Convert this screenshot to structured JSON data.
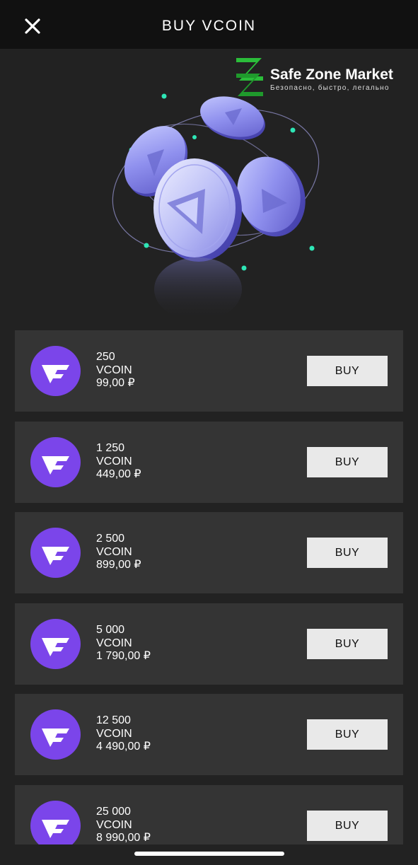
{
  "header": {
    "title": "BUY VCOIN",
    "close_icon": "close-icon"
  },
  "watermark": {
    "title": "Safe Zone Market",
    "subtitle": "Безопасно, быстро, легально",
    "brand_color": "#2bbd3a"
  },
  "offers": [
    {
      "amount": "250",
      "currency": "VCOIN",
      "price": "99,00 ₽",
      "button": "BUY"
    },
    {
      "amount": "1 250",
      "currency": "VCOIN",
      "price": "449,00 ₽",
      "button": "BUY"
    },
    {
      "amount": "2 500",
      "currency": "VCOIN",
      "price": "899,00 ₽",
      "button": "BUY"
    },
    {
      "amount": "5 000",
      "currency": "VCOIN",
      "price": "1 790,00 ₽",
      "button": "BUY"
    },
    {
      "amount": "12 500",
      "currency": "VCOIN",
      "price": "4 490,00 ₽",
      "button": "BUY"
    },
    {
      "amount": "25 000",
      "currency": "VCOIN",
      "price": "8 990,00 ₽",
      "button": "BUY"
    }
  ],
  "colors": {
    "background": "#222222",
    "header": "#111111",
    "card": "#343434",
    "accent": "#7b45ea",
    "button": "#e9e9e9"
  }
}
